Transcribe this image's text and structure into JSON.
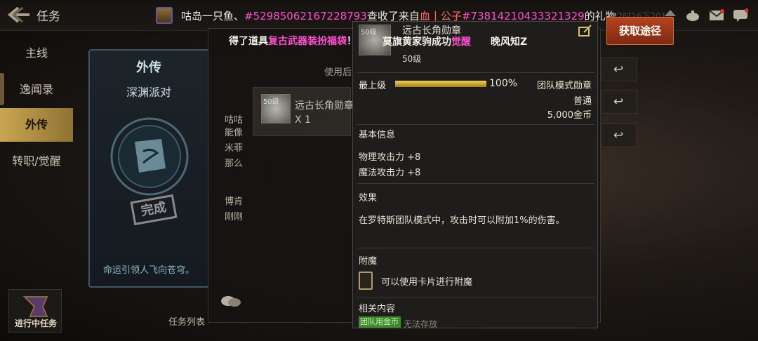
{
  "topbar": {
    "title": "任务",
    "clock": "22时16下2016",
    "broadcast": {
      "part1": "咕岛一只鱼、",
      "part2": "#52985062167228793",
      "part3": "查收了来自",
      "part4": "血丨公子",
      "part5": "#73814210433321329",
      "part6": "的礼物。"
    }
  },
  "nav": {
    "items": [
      "主线",
      "逸闻录",
      "外传",
      "转职/觉醒"
    ],
    "in_progress": "进行中任务"
  },
  "card": {
    "title": "外传",
    "subtitle": "深渊派对",
    "stamp": "完成",
    "description": "命运引领人飞向苍穹。",
    "task_list": "任务列表"
  },
  "panel": {
    "notification": {
      "prefix": "得了道具",
      "item": "复古武器装扮福袋",
      "suffix": "！"
    },
    "use_label": "使用后",
    "item": {
      "level_tag": "50级",
      "name": "远古长角勋章",
      "qty": "X 1"
    },
    "partial_lines": [
      "咕咕",
      "能像",
      "米菲",
      "那么",
      "博肯",
      "刚刚"
    ]
  },
  "acquire_button": "获取途径",
  "tooltip": {
    "name": "远古长角勋章",
    "overlay_notice": {
      "text": "莫旗黄家驹成功",
      "highlight": "觉醒",
      "trail": "晚风知Z"
    },
    "level": "50级",
    "icon_level": "50级",
    "max_level_label": "最上级",
    "progress": 100,
    "progress_text": "100%",
    "type": "团队模式勋章",
    "rarity": "普通",
    "price": "5,000金币",
    "basic_info_title": "基本信息",
    "stats": [
      "物理攻击力 +8",
      "魔法攻击力 +8"
    ],
    "effect_title": "效果",
    "effect_text": "在罗特斯团队模式中，攻击时可以附加1%的伤害。",
    "enchant_title": "附魔",
    "enchant_text": "可以使用卡片进行附魔",
    "related_title": "相关内容",
    "related_tag": "团队用金币",
    "related_text": "无法存放"
  },
  "colors": {
    "highlight_magenta": "#ff4fd0",
    "nav_active": "#c9a652",
    "acquire_button": "#b4431f",
    "progress_fill": "#f2cf54"
  }
}
